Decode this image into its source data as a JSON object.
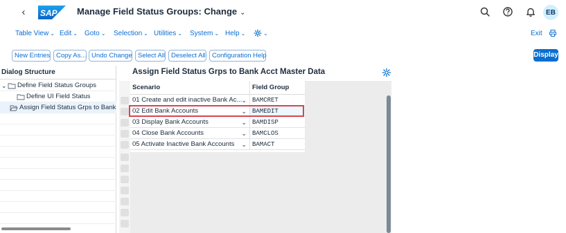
{
  "header": {
    "title": "Manage Field Status Groups: Change",
    "avatar_initials": "EB",
    "logo_text": "SAP"
  },
  "menubar": {
    "items": [
      "Table View",
      "Edit",
      "Goto",
      "Selection",
      "Utilities",
      "System",
      "Help"
    ],
    "exit_label": "Exit"
  },
  "toolbar": {
    "buttons": [
      "New Entries",
      "Copy As...",
      "Undo Change",
      "Select All",
      "Deselect All",
      "Configuration Help"
    ],
    "display_label": "Display"
  },
  "dialog_structure": {
    "heading": "Dialog Structure",
    "items": [
      "Define Field Status Groups",
      "Define UI Field Status",
      "Assign Field Status Grps to Bank Ac"
    ]
  },
  "main": {
    "title": "Assign Field Status Grps to Bank Acct Master Data",
    "columns": [
      "Scenario",
      "Field Group"
    ],
    "rows": [
      {
        "scenario": "01 Create and edit inactive Bank Ac...",
        "field_group": "BAMCRET"
      },
      {
        "scenario": "02 Edit Bank Accounts",
        "field_group": "BAMEDIT"
      },
      {
        "scenario": "03 Display Bank Accounts",
        "field_group": "BAMDISP"
      },
      {
        "scenario": "04 Close Bank Accounts",
        "field_group": "BAMCLOS"
      },
      {
        "scenario": "05 Activate Inactive Bank Accounts",
        "field_group": "BAMACT"
      }
    ],
    "highlight_color": "#d9434f"
  },
  "icons": {
    "back": "back-icon",
    "search": "search-icon",
    "help": "help-icon",
    "notifications": "bell-icon",
    "settings": "gear-icon",
    "print": "print-icon",
    "folder": "folder-icon"
  },
  "colors": {
    "accent": "#0a6ed1",
    "text": "#1d2d3e"
  }
}
